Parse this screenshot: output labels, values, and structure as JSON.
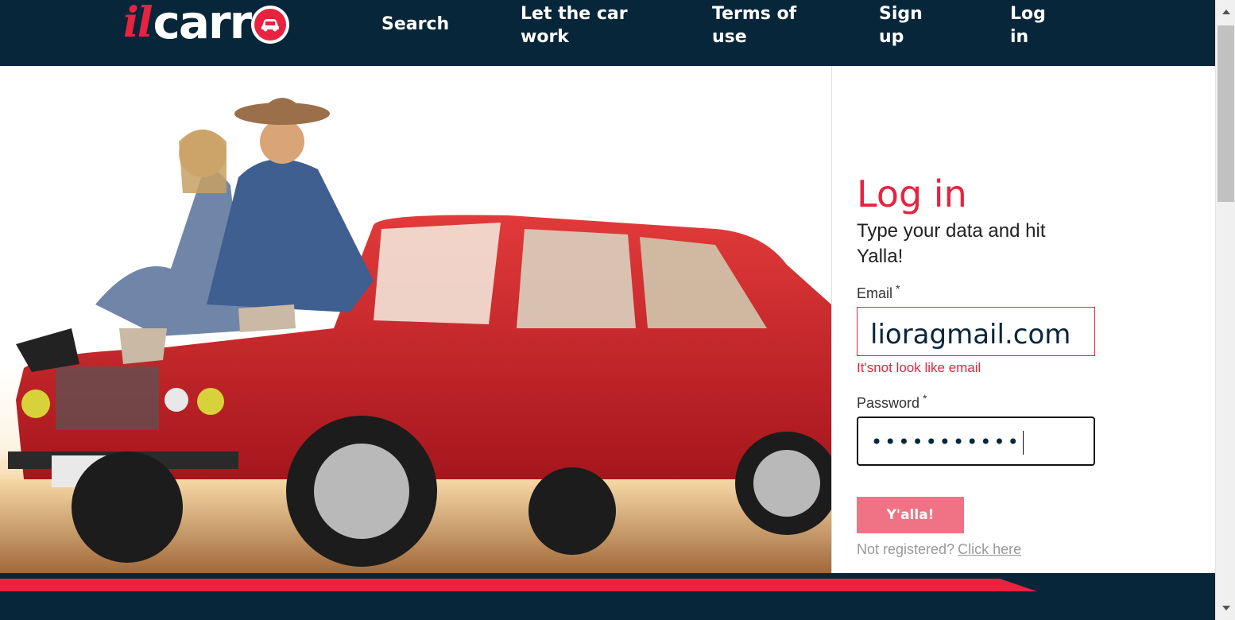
{
  "header": {
    "logo_il": "il",
    "logo_carr": "carr",
    "nav": {
      "search": "Search",
      "let_car_work": "Let the car work",
      "terms": "Terms of use",
      "signup": "Sign up",
      "login": "Log in"
    }
  },
  "hero": {
    "image_alt": "couple-on-red-car-photo"
  },
  "form": {
    "title": "Log in",
    "subtitle": "Type your data and hit Yalla!",
    "email_label": "Email",
    "email_value": "lioragmail.com",
    "email_error": "It'snot look like email",
    "password_label": "Password",
    "password_value": "•••••••••••",
    "required_mark": "*",
    "submit_label": "Y'alla!",
    "not_registered": "Not registered?",
    "click_here": "Click here"
  },
  "colors": {
    "navy": "#08263a",
    "brand_red": "#e8233f",
    "button_pink": "#ef7385"
  }
}
